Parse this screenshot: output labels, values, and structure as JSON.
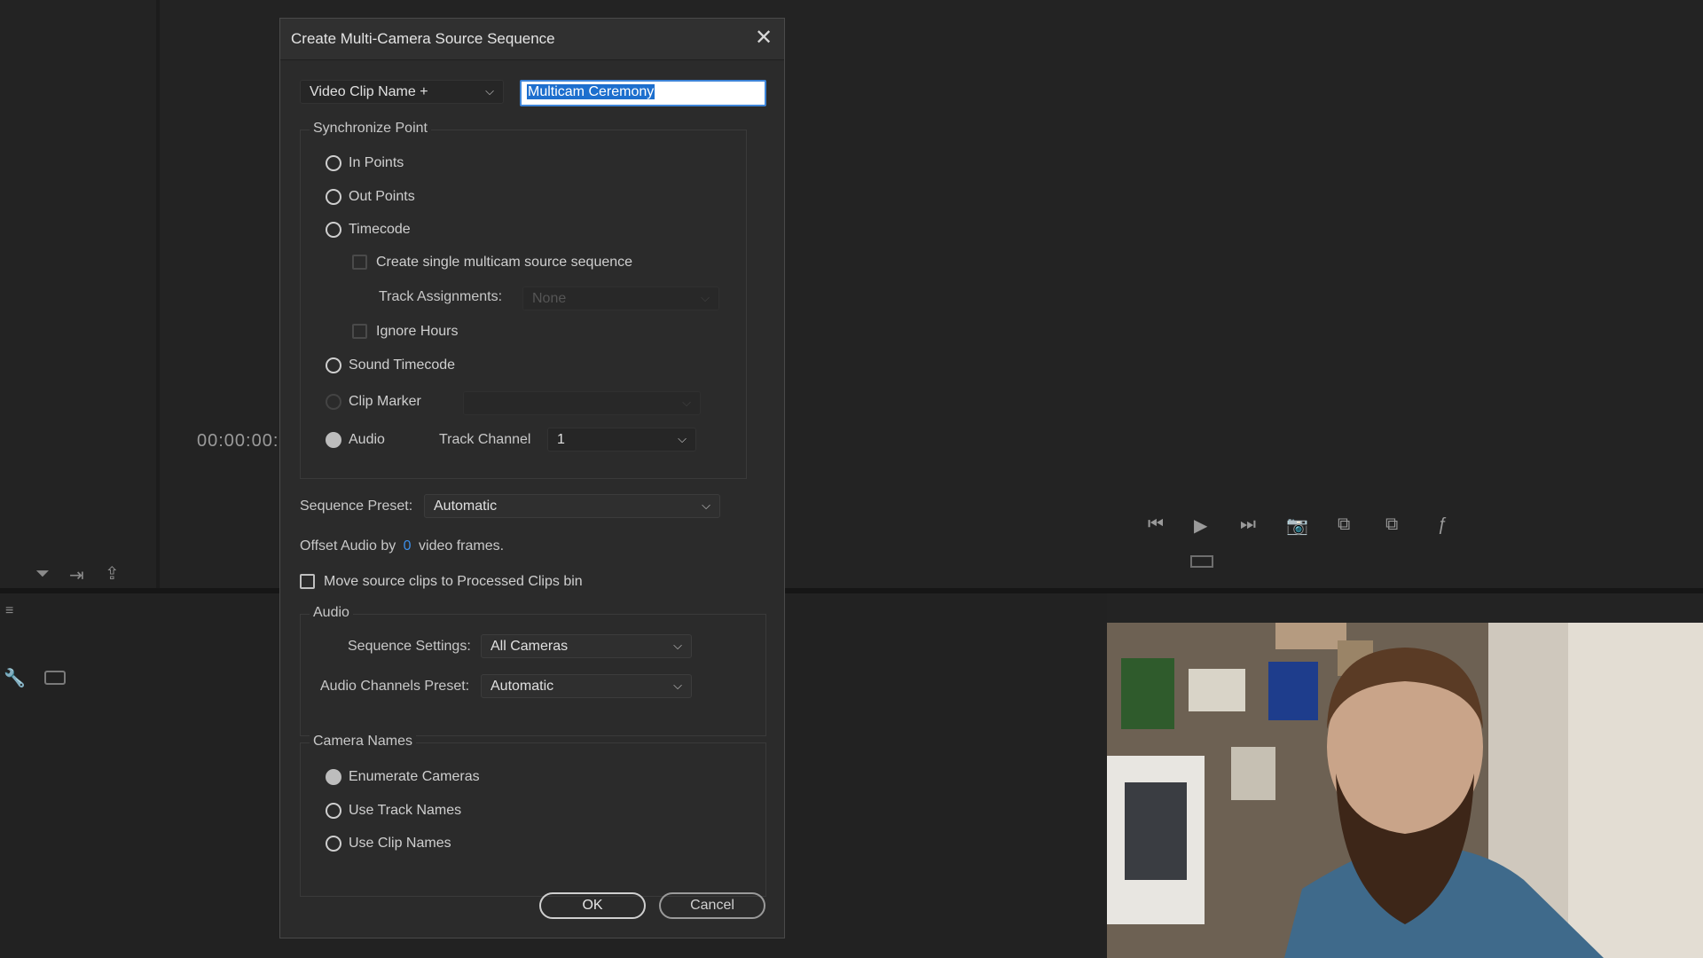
{
  "background": {
    "timecode": "00:00:00:"
  },
  "dialog": {
    "title": "Create Multi-Camera Source Sequence",
    "naming_dropdown": "Video Clip Name +",
    "name_input_selected": "Multicam Ceremony",
    "sync": {
      "title": "Synchronize Point",
      "options": [
        "In Points",
        "Out Points",
        "Timecode",
        "Sound Timecode",
        "Clip Marker",
        "Audio"
      ],
      "selected": "Audio",
      "create_single": "Create single multicam source sequence",
      "track_assignments_label": "Track Assignments:",
      "track_assignments_value": "None",
      "ignore_hours": "Ignore Hours",
      "track_channel_label": "Track Channel",
      "track_channel_value": "1"
    },
    "sequence_preset_label": "Sequence Preset:",
    "sequence_preset_value": "Automatic",
    "offset_prefix": "Offset Audio by",
    "offset_value": "0",
    "offset_suffix": "video frames.",
    "move_clips_label": "Move source clips to Processed Clips bin",
    "audio": {
      "title": "Audio",
      "sequence_settings_label": "Sequence Settings:",
      "sequence_settings_value": "All Cameras",
      "channels_preset_label": "Audio Channels Preset:",
      "channels_preset_value": "Automatic"
    },
    "camera_names": {
      "title": "Camera Names",
      "options": [
        "Enumerate Cameras",
        "Use Track Names",
        "Use Clip Names"
      ],
      "selected": "Enumerate Cameras"
    },
    "ok_label": "OK",
    "cancel_label": "Cancel"
  },
  "colors": {
    "accent": "#3c8ee8",
    "dialog_bg": "#2b2b2b",
    "app_bg": "#232323"
  }
}
